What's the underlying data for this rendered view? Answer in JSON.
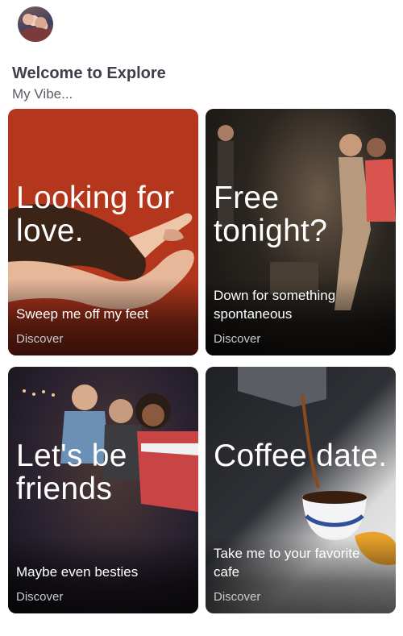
{
  "header": {
    "title": "Welcome to Explore",
    "subtitle": "My Vibe..."
  },
  "cards": [
    {
      "headline": "Looking for love.",
      "subline": "Sweep me off my feet",
      "discover": "Discover"
    },
    {
      "headline": "Free tonight?",
      "subline": "Down for something spontaneous",
      "discover": "Discover"
    },
    {
      "headline": "Let's be friends",
      "subline": "Maybe even besties",
      "discover": "Discover"
    },
    {
      "headline": "Coffee date.",
      "subline": "Take me to your favorite cafe",
      "discover": "Discover"
    }
  ],
  "colors": {
    "love_card_bg": "#b3361d",
    "title_text": "#3f3f4a",
    "discover_text": "#c9c9cf"
  },
  "icons": {
    "profile": "avatar-photo"
  }
}
